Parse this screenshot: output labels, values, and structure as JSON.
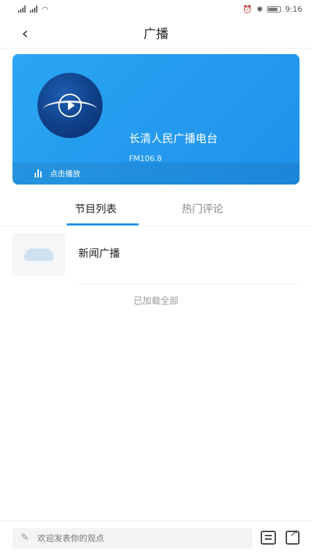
{
  "status_bar": {
    "time": "9:16"
  },
  "header": {
    "title": "广播"
  },
  "station": {
    "name": "长清人民广播电台",
    "frequency": "FM106.8",
    "play_label": "点击播放"
  },
  "tabs": [
    {
      "label": "节目列表"
    },
    {
      "label": "热门评论"
    }
  ],
  "programs": [
    {
      "title": "新闻广播"
    }
  ],
  "list_status": "已加载全部",
  "bottom_bar": {
    "placeholder": "欢迎发表你的观点"
  },
  "colors": {
    "accent": "#1f90ea",
    "card_gradient_start": "#2aa6f3",
    "card_gradient_end": "#1f90ea"
  },
  "icons": {
    "back": "chevron-left-icon",
    "play_bars": "bars-icon",
    "comment": "comment-icon",
    "share": "share-icon",
    "pencil": "pencil-icon"
  }
}
